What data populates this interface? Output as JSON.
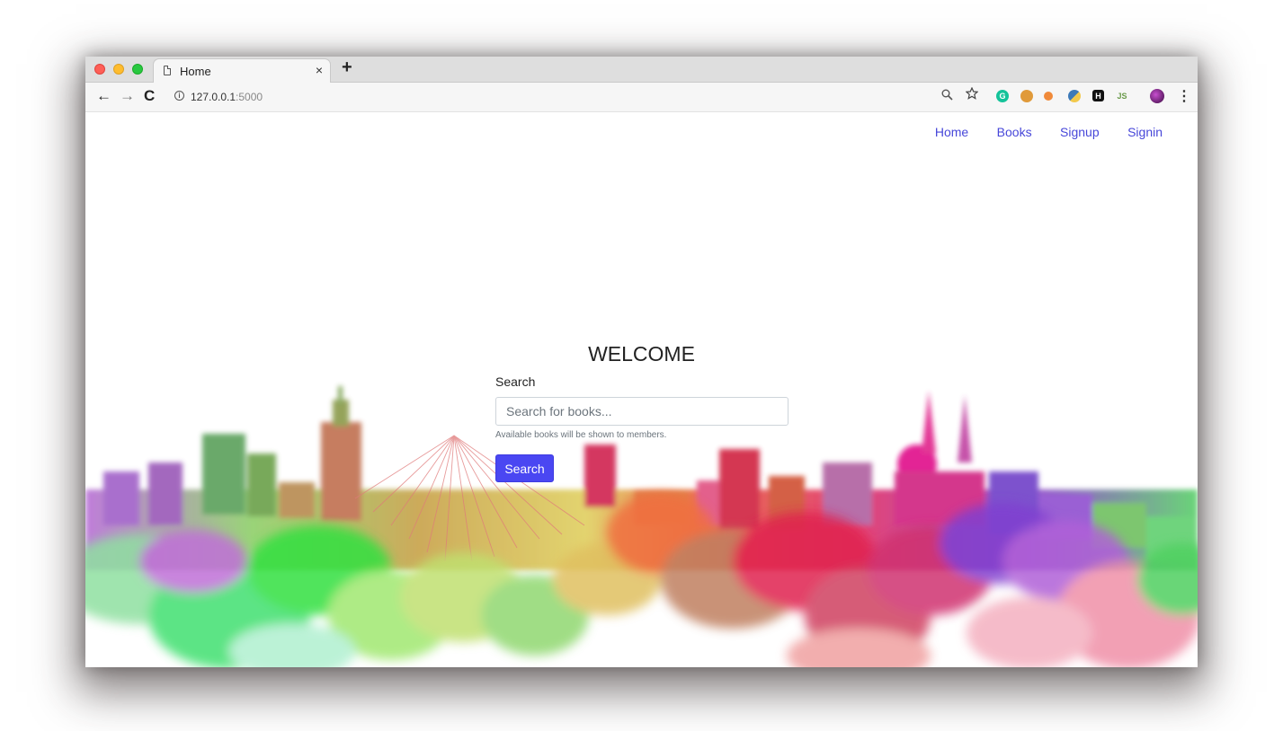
{
  "browser": {
    "tab_title": "Home",
    "tab_close": "×",
    "new_tab": "+",
    "url_host": "127.0.0.1",
    "url_port": ":5000",
    "nav": {
      "back": "←",
      "forward": "→",
      "reload": "C"
    },
    "toolbar_icons": [
      "zoom-icon",
      "bookmark-star-icon"
    ],
    "extensions": [
      {
        "name": "grammarly-extension-icon",
        "color": "#15c39a",
        "glyph": "G"
      },
      {
        "name": "cookie-extension-icon",
        "color": "#e09a3a",
        "glyph": ""
      },
      {
        "name": "flower-extension-icon",
        "color": "#f08a3a",
        "glyph": ""
      },
      {
        "name": "python-extension-icon",
        "color": "#3d7ab8",
        "glyph": ""
      },
      {
        "name": "h-extension-icon",
        "color": "#111111",
        "glyph": "H"
      },
      {
        "name": "nodejs-extension-icon",
        "color": "#7bb45a",
        "glyph": ""
      },
      {
        "name": "profile-avatar-icon",
        "color": "#4b1055",
        "glyph": ""
      }
    ],
    "menu_glyph": "⋮"
  },
  "nav": {
    "items": [
      "Home",
      "Books",
      "Signup",
      "Signin"
    ]
  },
  "main": {
    "heading": "WELCOME",
    "search_label": "Search",
    "search_placeholder": "Search for books...",
    "search_value": "",
    "help_text": "Available books will be shown to members.",
    "search_button": "Search"
  },
  "colors": {
    "link": "#4747d9",
    "button": "#4a47f2"
  }
}
